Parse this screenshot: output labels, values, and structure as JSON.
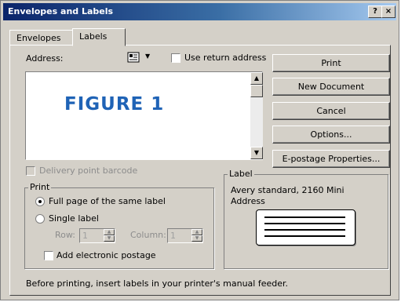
{
  "window": {
    "title": "Envelopes and Labels",
    "help_button": "?",
    "close_button": "×"
  },
  "tabs": [
    {
      "label": "Envelopes"
    },
    {
      "label": "Labels"
    }
  ],
  "address": {
    "label": "Address:",
    "content": "FIGURE 1",
    "address_book_icon": "address-book-icon",
    "use_return_address": "Use return address",
    "use_return_address_checked": false
  },
  "buttons": {
    "print": "Print",
    "new_document": "New Document",
    "cancel": "Cancel",
    "options": "Options...",
    "epostage": "E-postage Properties..."
  },
  "delivery_barcode": {
    "label": "Delivery point barcode",
    "checked": false,
    "enabled": false
  },
  "print_group": {
    "title": "Print",
    "full_page": "Full page of the same label",
    "single_label": "Single label",
    "selected": "full_page",
    "row_label": "Row:",
    "row_value": "1",
    "column_label": "Column:",
    "column_value": "1",
    "add_epostage": "Add electronic postage",
    "add_epostage_checked": false
  },
  "label_group": {
    "title": "Label",
    "line1": "Avery standard, 2160 Mini",
    "line2": "Address"
  },
  "status_text": "Before printing, insert labels in your printer's manual feeder."
}
